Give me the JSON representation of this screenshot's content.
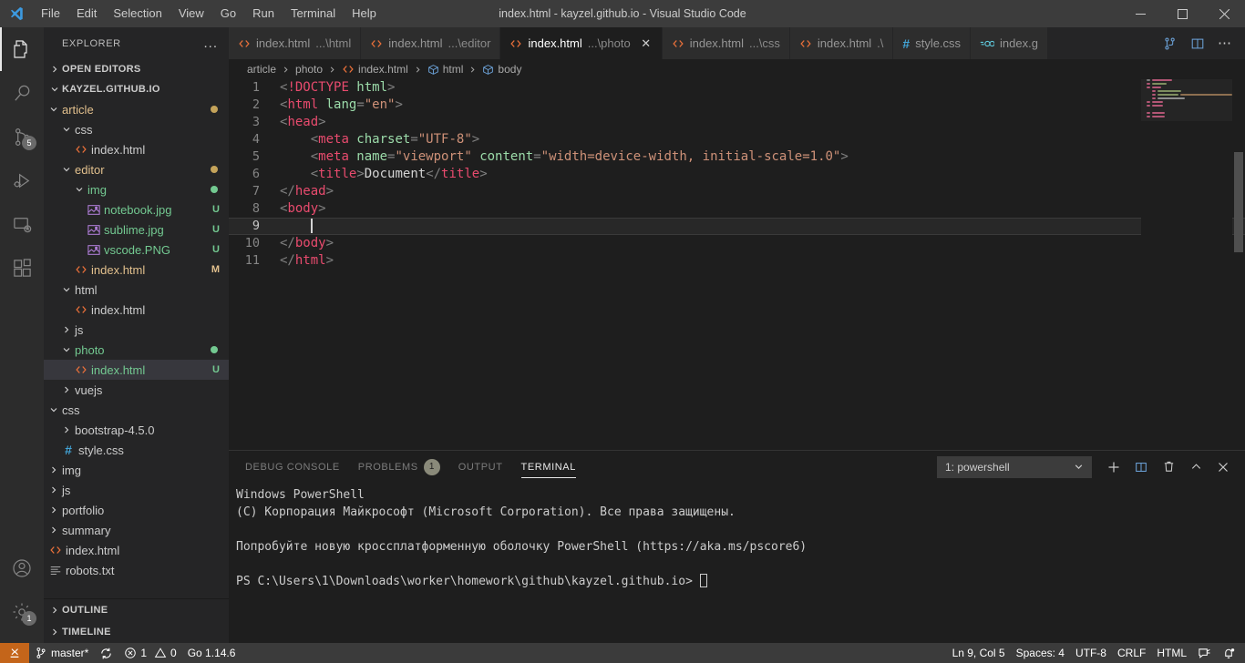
{
  "window": {
    "title": "index.html - kayzel.github.io - Visual Studio Code",
    "minimize": "minimize-icon",
    "maximize": "maximize-icon",
    "close": "close-icon"
  },
  "menu": {
    "items": [
      "File",
      "Edit",
      "Selection",
      "View",
      "Go",
      "Run",
      "Terminal",
      "Help"
    ]
  },
  "activitybar": {
    "items": [
      {
        "name": "explorer",
        "icon": "files-icon",
        "active": true,
        "badge": ""
      },
      {
        "name": "search",
        "icon": "search-icon",
        "active": false,
        "badge": ""
      },
      {
        "name": "source-control",
        "icon": "source-control-icon",
        "active": false,
        "badge": "5"
      },
      {
        "name": "run-and-debug",
        "icon": "debug-icon",
        "active": false,
        "badge": ""
      },
      {
        "name": "remote-explorer",
        "icon": "remote-icon",
        "active": false,
        "badge": ""
      },
      {
        "name": "extensions",
        "icon": "extensions-icon",
        "active": false,
        "badge": ""
      }
    ],
    "bottom": [
      {
        "name": "accounts",
        "icon": "account-icon",
        "badge": ""
      },
      {
        "name": "manage",
        "icon": "gear-icon",
        "badge": "1"
      }
    ]
  },
  "sidebar": {
    "title": "EXPLORER",
    "more_actions": "...",
    "open_editors_label": "OPEN EDITORS",
    "workspace_label": "KAYZEL.GITHUB.IO",
    "outline_label": "OUTLINE",
    "timeline_label": "TIMELINE",
    "tree": [
      {
        "label": "article",
        "indent": 1,
        "type": "folder",
        "open": true,
        "color": "mod",
        "dot": "#c4a35a",
        "status": ""
      },
      {
        "label": "css",
        "indent": 2,
        "type": "folder",
        "open": true,
        "color": "folder",
        "dot": "",
        "status": ""
      },
      {
        "label": "index.html",
        "indent": 3,
        "type": "html",
        "open": null,
        "color": "folder",
        "dot": "",
        "status": ""
      },
      {
        "label": "editor",
        "indent": 2,
        "type": "folder",
        "open": true,
        "color": "mod",
        "dot": "#c4a35a",
        "status": ""
      },
      {
        "label": "img",
        "indent": 3,
        "type": "folder",
        "open": true,
        "color": "new",
        "dot": "#73c991",
        "status": ""
      },
      {
        "label": "notebook.jpg",
        "indent": 4,
        "type": "image",
        "open": null,
        "color": "new",
        "dot": "",
        "status": "U"
      },
      {
        "label": "sublime.jpg",
        "indent": 4,
        "type": "image",
        "open": null,
        "color": "new",
        "dot": "",
        "status": "U"
      },
      {
        "label": "vscode.PNG",
        "indent": 4,
        "type": "image",
        "open": null,
        "color": "new",
        "dot": "",
        "status": "U"
      },
      {
        "label": "index.html",
        "indent": 3,
        "type": "html",
        "open": null,
        "color": "mod",
        "dot": "",
        "status": "M"
      },
      {
        "label": "html",
        "indent": 2,
        "type": "folder",
        "open": true,
        "color": "folder",
        "dot": "",
        "status": ""
      },
      {
        "label": "index.html",
        "indent": 3,
        "type": "html",
        "open": null,
        "color": "folder",
        "dot": "",
        "status": ""
      },
      {
        "label": "js",
        "indent": 2,
        "type": "folder",
        "open": false,
        "color": "folder",
        "dot": "",
        "status": ""
      },
      {
        "label": "photo",
        "indent": 2,
        "type": "folder",
        "open": true,
        "color": "new",
        "dot": "#73c991",
        "status": ""
      },
      {
        "label": "index.html",
        "indent": 3,
        "type": "html",
        "open": null,
        "color": "new",
        "dot": "",
        "status": "U",
        "selected": true
      },
      {
        "label": "vuejs",
        "indent": 2,
        "type": "folder",
        "open": false,
        "color": "folder",
        "dot": "",
        "status": ""
      },
      {
        "label": "css",
        "indent": 1,
        "type": "folder",
        "open": true,
        "color": "folder",
        "dot": "",
        "status": ""
      },
      {
        "label": "bootstrap-4.5.0",
        "indent": 2,
        "type": "folder",
        "open": false,
        "color": "folder",
        "dot": "",
        "status": ""
      },
      {
        "label": "style.css",
        "indent": 2,
        "type": "css",
        "open": null,
        "color": "folder",
        "dot": "",
        "status": ""
      },
      {
        "label": "img",
        "indent": 1,
        "type": "folder",
        "open": false,
        "color": "folder",
        "dot": "",
        "status": ""
      },
      {
        "label": "js",
        "indent": 1,
        "type": "folder",
        "open": false,
        "color": "folder",
        "dot": "",
        "status": ""
      },
      {
        "label": "portfolio",
        "indent": 1,
        "type": "folder",
        "open": false,
        "color": "folder",
        "dot": "",
        "status": ""
      },
      {
        "label": "summary",
        "indent": 1,
        "type": "folder",
        "open": false,
        "color": "folder",
        "dot": "",
        "status": ""
      },
      {
        "label": "index.html",
        "indent": 1,
        "type": "html",
        "open": null,
        "color": "folder",
        "dot": "",
        "status": ""
      },
      {
        "label": "robots.txt",
        "indent": 1,
        "type": "text",
        "open": null,
        "color": "folder",
        "dot": "",
        "status": ""
      }
    ]
  },
  "tabs": [
    {
      "name": "index.html",
      "suffix": "...\\html",
      "icon": "html-icon",
      "active": false,
      "close": ""
    },
    {
      "name": "index.html",
      "suffix": "...\\editor",
      "icon": "html-icon",
      "active": false,
      "close": ""
    },
    {
      "name": "index.html",
      "suffix": "...\\photo",
      "icon": "html-icon",
      "active": true,
      "close": "✕"
    },
    {
      "name": "index.html",
      "suffix": "...\\css",
      "icon": "html-icon",
      "active": false,
      "close": ""
    },
    {
      "name": "index.html",
      "suffix": ".\\",
      "icon": "html-icon",
      "active": false,
      "close": ""
    },
    {
      "name": "style.css",
      "suffix": "",
      "icon": "css-icon",
      "active": false,
      "close": ""
    },
    {
      "name": "index.g",
      "suffix": "",
      "icon": "go-icon",
      "active": false,
      "close": ""
    }
  ],
  "tab_actions": [
    {
      "name": "split-editor-down-icon"
    },
    {
      "name": "split-editor-icon"
    },
    {
      "name": "more-actions-icon"
    }
  ],
  "breadcrumbs": [
    {
      "label": "article",
      "icon": ""
    },
    {
      "label": "photo",
      "icon": ""
    },
    {
      "label": "index.html",
      "icon": "html-icon"
    },
    {
      "label": "html",
      "icon": "symbol-icon"
    },
    {
      "label": "body",
      "icon": "symbol-icon"
    }
  ],
  "editor": {
    "lines": [
      {
        "n": "1",
        "tokens": [
          {
            "t": "<",
            "c": "br"
          },
          {
            "t": "!DOCTYPE",
            "c": "dkw"
          },
          {
            "t": " html",
            "c": "attr"
          },
          {
            "t": ">",
            "c": "br"
          }
        ]
      },
      {
        "n": "2",
        "tokens": [
          {
            "t": "<",
            "c": "br"
          },
          {
            "t": "html",
            "c": "tag"
          },
          {
            "t": " lang",
            "c": "attr"
          },
          {
            "t": "=",
            "c": "br"
          },
          {
            "t": "\"en\"",
            "c": "str"
          },
          {
            "t": ">",
            "c": "br"
          }
        ]
      },
      {
        "n": "3",
        "tokens": [
          {
            "t": "<",
            "c": "br"
          },
          {
            "t": "head",
            "c": "tag"
          },
          {
            "t": ">",
            "c": "br"
          }
        ]
      },
      {
        "n": "4",
        "tokens": [
          {
            "t": "    <",
            "c": "br"
          },
          {
            "t": "meta",
            "c": "tag"
          },
          {
            "t": " charset",
            "c": "attr"
          },
          {
            "t": "=",
            "c": "br"
          },
          {
            "t": "\"UTF-8\"",
            "c": "str"
          },
          {
            "t": ">",
            "c": "br"
          }
        ]
      },
      {
        "n": "5",
        "tokens": [
          {
            "t": "    <",
            "c": "br"
          },
          {
            "t": "meta",
            "c": "tag"
          },
          {
            "t": " name",
            "c": "attr"
          },
          {
            "t": "=",
            "c": "br"
          },
          {
            "t": "\"viewport\"",
            "c": "str"
          },
          {
            "t": " content",
            "c": "attr"
          },
          {
            "t": "=",
            "c": "br"
          },
          {
            "t": "\"width=device-width, initial-scale=1.0\"",
            "c": "str"
          },
          {
            "t": ">",
            "c": "br"
          }
        ]
      },
      {
        "n": "6",
        "tokens": [
          {
            "t": "    <",
            "c": "br"
          },
          {
            "t": "title",
            "c": "tag"
          },
          {
            "t": ">",
            "c": "br"
          },
          {
            "t": "Document",
            "c": "txt"
          },
          {
            "t": "</",
            "c": "br"
          },
          {
            "t": "title",
            "c": "tag"
          },
          {
            "t": ">",
            "c": "br"
          }
        ]
      },
      {
        "n": "7",
        "tokens": [
          {
            "t": "</",
            "c": "br"
          },
          {
            "t": "head",
            "c": "tag"
          },
          {
            "t": ">",
            "c": "br"
          }
        ]
      },
      {
        "n": "8",
        "tokens": [
          {
            "t": "<",
            "c": "br"
          },
          {
            "t": "body",
            "c": "tag"
          },
          {
            "t": ">",
            "c": "br"
          }
        ]
      },
      {
        "n": "9",
        "tokens": [
          {
            "t": "    ",
            "c": "txt"
          }
        ],
        "current": true,
        "caret": true
      },
      {
        "n": "10",
        "tokens": [
          {
            "t": "</",
            "c": "br"
          },
          {
            "t": "body",
            "c": "tag"
          },
          {
            "t": ">",
            "c": "br"
          }
        ]
      },
      {
        "n": "11",
        "tokens": [
          {
            "t": "</",
            "c": "br"
          },
          {
            "t": "html",
            "c": "tag"
          },
          {
            "t": ">",
            "c": "br"
          }
        ]
      }
    ]
  },
  "panel": {
    "tabs": [
      {
        "label": "DEBUG CONSOLE",
        "active": false,
        "badge": ""
      },
      {
        "label": "PROBLEMS",
        "active": false,
        "badge": "1"
      },
      {
        "label": "OUTPUT",
        "active": false,
        "badge": ""
      },
      {
        "label": "TERMINAL",
        "active": true,
        "badge": ""
      }
    ],
    "terminal_select": "1: powershell",
    "actions": [
      {
        "name": "new-terminal-icon"
      },
      {
        "name": "split-terminal-icon"
      },
      {
        "name": "kill-terminal-icon"
      },
      {
        "name": "maximize-panel-icon"
      },
      {
        "name": "close-panel-icon"
      }
    ],
    "terminal_lines": [
      "Windows PowerShell",
      "(C) Корпорация Майкрософт (Microsoft Corporation). Все права защищены.",
      "",
      "Попробуйте новую кроссплатформенную оболочку PowerShell (https://aka.ms/pscore6)",
      ""
    ],
    "prompt": "PS C:\\Users\\1\\Downloads\\worker\\homework\\github\\kayzel.github.io>"
  },
  "statusbar": {
    "remote": "remote-icon",
    "branch": "master*",
    "sync": "sync-icon",
    "errors": "1",
    "warnings": "0",
    "go_version": "Go 1.14.6",
    "position": "Ln 9, Col 5",
    "spaces": "Spaces: 4",
    "encoding": "UTF-8",
    "eol": "CRLF",
    "language": "HTML",
    "feedback": "feedback-icon",
    "bell": "bell-icon"
  },
  "colors": {
    "accent": "#c4651a",
    "modified": "#e2c08d",
    "untracked": "#73c991",
    "tag": "#e94b6e",
    "attr": "#9cdcaa",
    "string": "#ce9178"
  }
}
